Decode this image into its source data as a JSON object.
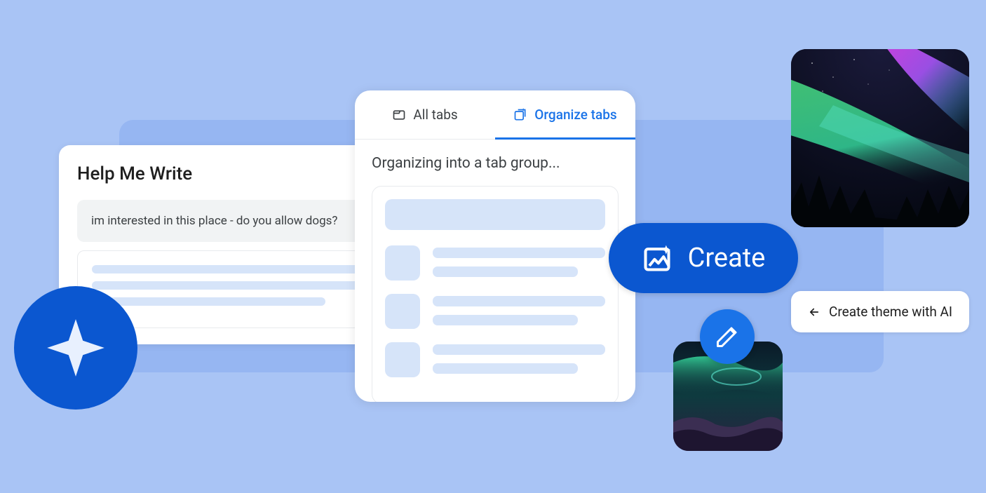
{
  "help_write": {
    "title": "Help Me Write",
    "input_text": "im interested in this place - do you allow dogs?"
  },
  "organize": {
    "tab_all": "All tabs",
    "tab_organize": "Organize tabs",
    "status": "Organizing into a tab group..."
  },
  "create_button": {
    "label": "Create"
  },
  "theme_chip": {
    "label": "Create theme with AI"
  },
  "icons": {
    "sparkle": "sparkle-icon",
    "tab": "tab-icon",
    "organize": "organize-tabs-icon",
    "image_sparkle": "image-sparkle-icon",
    "arrow_left": "arrow-left-icon",
    "pencil": "pencil-icon"
  }
}
